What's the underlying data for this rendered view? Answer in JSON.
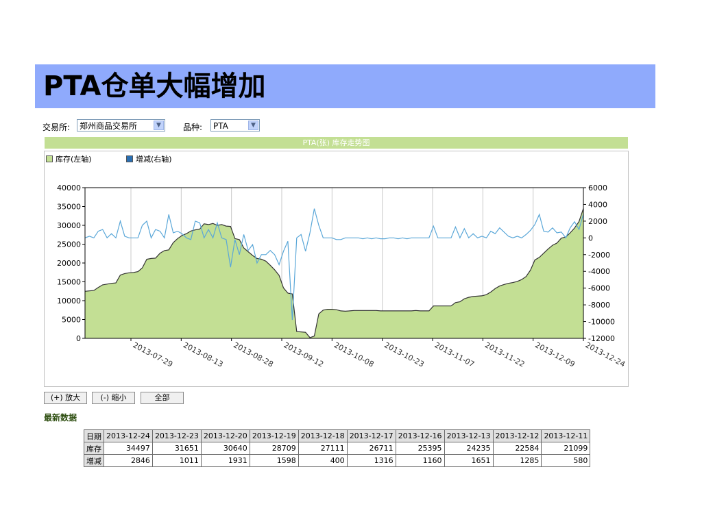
{
  "title": "PTA仓单大幅增加",
  "filters": {
    "exchange_label": "交易所:",
    "exchange_value": "郑州商品交易所",
    "product_label": "品种:",
    "product_value": "PTA"
  },
  "chart_header": "PTA(张) 库存走势图",
  "buttons": {
    "zoom_in": "(+) 放大",
    "zoom_out": "(-) 缩小",
    "all": "全部"
  },
  "latest_title": "最新数据",
  "table": {
    "row_labels": [
      "日期",
      "库存",
      "增减"
    ],
    "dates": [
      "2013-12-24",
      "2013-12-23",
      "2013-12-20",
      "2013-12-19",
      "2013-12-18",
      "2013-12-17",
      "2013-12-16",
      "2013-12-13",
      "2013-12-12",
      "2013-12-11"
    ],
    "inventory": [
      "34497",
      "31651",
      "30640",
      "28709",
      "27111",
      "26711",
      "25395",
      "24235",
      "22584",
      "21099"
    ],
    "change": [
      "2846",
      "1011",
      "1931",
      "1598",
      "400",
      "1316",
      "1160",
      "1651",
      "1285",
      "580"
    ]
  },
  "colors": {
    "area_fill": "#c3df94",
    "area_line": "#333333",
    "change_line": "#5aa7d8",
    "header_bg": "#c3df94",
    "title_bg": "#8faafc"
  },
  "chart_data": {
    "type": "area",
    "legend": [
      "库存(左轴)",
      "增减(右轴)"
    ],
    "legend_placement": "top-left",
    "grid": true,
    "y_left": {
      "min": 0,
      "max": 40000,
      "ticks": [
        0,
        5000,
        10000,
        15000,
        20000,
        25000,
        30000,
        35000,
        40000
      ]
    },
    "y_right": {
      "min": -12000,
      "max": 6000,
      "ticks": [
        -12000,
        -10000,
        -8000,
        -6000,
        -4000,
        -2000,
        0,
        2000,
        4000,
        6000
      ]
    },
    "x_ticks": [
      "2013-07-29",
      "2013-08-13",
      "2013-08-28",
      "2013-09-12",
      "2013-10-08",
      "2013-10-23",
      "2013-11-07",
      "2013-11-22",
      "2013-12-09",
      "2013-12-24"
    ],
    "series": [
      {
        "name": "库存(左轴)",
        "axis": "left",
        "values": [
          12500,
          12600,
          12700,
          13500,
          14200,
          14400,
          14600,
          14700,
          16800,
          17200,
          17400,
          17500,
          17700,
          18700,
          21000,
          21200,
          21300,
          22600,
          23300,
          23500,
          25400,
          26500,
          27300,
          27800,
          28500,
          28800,
          29000,
          30400,
          30200,
          30500,
          30000,
          30200,
          29800,
          29700,
          26500,
          26200,
          24000,
          23000,
          22000,
          21200,
          21000,
          20500,
          19400,
          18200,
          16700,
          13400,
          12000,
          11800,
          1800,
          1700,
          1600,
          200,
          600,
          6500,
          7500,
          7700,
          7700,
          7600,
          7300,
          7200,
          7300,
          7400,
          7400,
          7400,
          7400,
          7400,
          7400,
          7300,
          7300,
          7300,
          7300,
          7300,
          7300,
          7300,
          7300,
          7400,
          7300,
          7300,
          7300,
          8600,
          8600,
          8600,
          8600,
          8600,
          9500,
          9700,
          10500,
          10900,
          11100,
          11200,
          11300,
          11600,
          12300,
          13200,
          13900,
          14300,
          14600,
          14800,
          15100,
          15600,
          16400,
          18100,
          20800,
          21500,
          22600,
          23700,
          24700,
          25300,
          26600,
          26900,
          28000,
          29300,
          31000,
          34497
        ]
      },
      {
        "name": "增减(右轴)",
        "axis": "right",
        "values": [
          0,
          200,
          0,
          800,
          1000,
          0,
          500,
          0,
          2000,
          200,
          0,
          0,
          0,
          1500,
          2000,
          0,
          1000,
          800,
          0,
          2800,
          600,
          800,
          500,
          0,
          -200,
          2000,
          1800,
          0,
          1000,
          0,
          1800,
          0,
          -200,
          -3500,
          -200,
          -2000,
          400,
          -1500,
          -800,
          -3000,
          -2000,
          -2000,
          -1500,
          -2000,
          -3200,
          -1600,
          -400,
          -9800,
          0,
          400,
          -1600,
          600,
          3500,
          1500,
          0,
          0,
          0,
          -200,
          -200,
          0,
          0,
          0,
          0,
          -100,
          0,
          -100,
          0,
          -100,
          -100,
          0,
          0,
          -100,
          0,
          -100,
          0,
          0,
          0,
          0,
          0,
          1400,
          0,
          0,
          0,
          0,
          1300,
          0,
          1100,
          0,
          500,
          0,
          200,
          0,
          800,
          500,
          1200,
          700,
          200,
          0,
          200,
          0,
          400,
          900,
          1600,
          2800,
          800,
          700,
          1200,
          600,
          700,
          0,
          1200,
          1931,
          1011,
          2846
        ]
      }
    ]
  }
}
